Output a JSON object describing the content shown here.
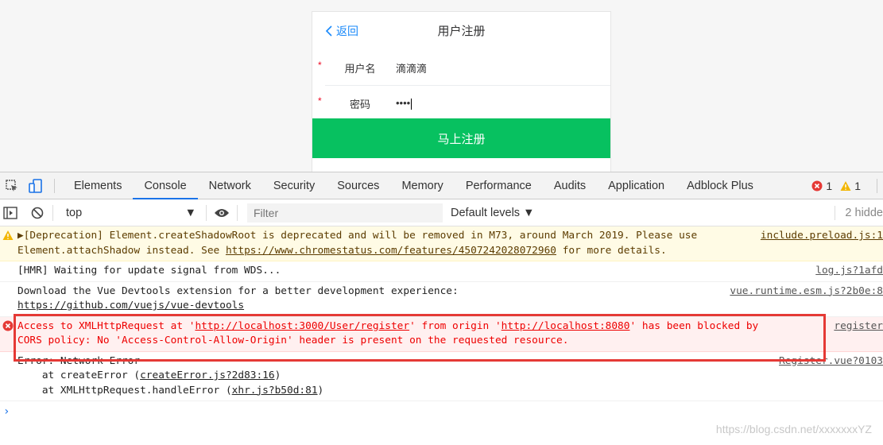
{
  "phone": {
    "back_label": "返回",
    "title": "用户注册",
    "username_label": "用户名",
    "username_value": "滴滴滴",
    "password_label": "密码",
    "password_value": "••••",
    "required_mark": "*",
    "submit_label": "马上注册"
  },
  "devtools": {
    "tabs": [
      "Elements",
      "Console",
      "Network",
      "Security",
      "Sources",
      "Memory",
      "Performance",
      "Audits",
      "Application",
      "Adblock Plus"
    ],
    "active_tab": "Console",
    "error_count": "1",
    "warning_count": "1",
    "context": "top",
    "filter_placeholder": "Filter",
    "levels": "Default levels",
    "hidden_count": "2 hidde"
  },
  "messages": {
    "warn_line1_prefix": "▶[Deprecation] Element.createShadowRoot is deprecated and will be removed in M73, around March 2019. Please use ",
    "warn_line1_link": "include.preload.js:1",
    "warn_line2_prefix": "Element.attachShadow instead. See ",
    "warn_line2_link": "https://www.chromestatus.com/features/4507242028072960",
    "warn_line2_suffix": " for more details.",
    "hmr_text": "[HMR] Waiting for update signal from WDS...",
    "hmr_src": "log.js?1afd",
    "devtools_text": "Download the Vue Devtools extension for a better development experience:",
    "devtools_link": "https://github.com/vuejs/vue-devtools",
    "devtools_src": "vue.runtime.esm.js?2b0e:8",
    "err_a": "Access to XMLHttpRequest at '",
    "err_url1": "http://localhost:3000/User/register",
    "err_b": "' from origin '",
    "err_url2": "http://localhost:8080",
    "err_c": "' has been blocked by",
    "err_line2": "CORS policy: No 'Access-Control-Allow-Origin' header is present on the requested resource.",
    "err_src": "register",
    "net_err": "Error: Network Error",
    "stack1_pre": "    at createError (",
    "stack1_link": "createError.js?2d83:16",
    "stack1_post": ")",
    "stack2_pre": "    at XMLHttpRequest.handleError (",
    "stack2_link": "xhr.js?b50d:81",
    "stack2_post": ")",
    "net_src": "Register.vue?0103",
    "prompt": "›"
  },
  "watermark": "https://blog.csdn.net/xxxxxxxYZ",
  "colors": {
    "accent": "#1a73e8",
    "submit": "#07c160",
    "error": "#e00000",
    "highlight": "#e53935"
  }
}
